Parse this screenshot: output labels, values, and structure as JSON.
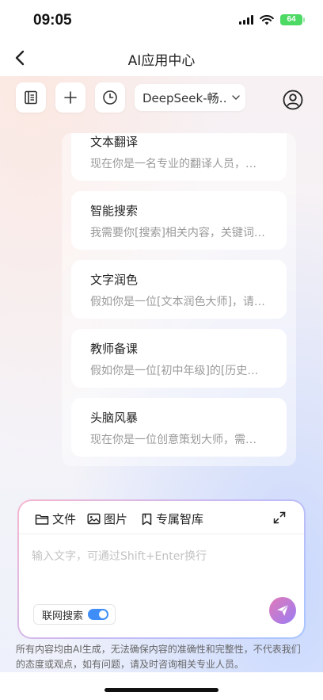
{
  "status_bar": {
    "time": "09:05",
    "battery": "64"
  },
  "nav": {
    "title": "AI应用中心"
  },
  "toolbar": {
    "model_label": "DeepSeek-畅…"
  },
  "prompts": [
    {
      "title": "文本翻译",
      "desc": "现在你是一名专业的翻译人员，…"
    },
    {
      "title": "智能搜索",
      "desc": "我需要你[搜索]相关内容，关键词…"
    },
    {
      "title": "文字润色",
      "desc": "假如你是一位[文本润色大师]，请…"
    },
    {
      "title": "教师备课",
      "desc": "假如你是一位[初中年级]的[历史…"
    },
    {
      "title": "头脑风暴",
      "desc": "现在你是一位创意策划大师，需…"
    }
  ],
  "chat": {
    "file_label": "文件",
    "image_label": "图片",
    "library_label": "专属智库",
    "input_placeholder": "输入文字，可通过Shift+Enter换行",
    "web_search_label": "联网搜索",
    "web_search_on": true
  },
  "disclaimer": "所有内容均由AI生成，无法确保内容的准确性和完整性，不代表我们的态度或观点，如有问题，请及时咨询相关专业人员。",
  "colors": {
    "accent": "#3f8ef7",
    "send_gradient_start": "#e07ab7",
    "send_gradient_end": "#9b7cf4"
  },
  "icons": [
    "back-arrow-icon",
    "history-list-icon",
    "plus-icon",
    "clock-icon",
    "chevron-down-icon",
    "user-icon",
    "folder-icon",
    "image-icon",
    "bookmark-icon",
    "expand-icon",
    "send-icon"
  ]
}
